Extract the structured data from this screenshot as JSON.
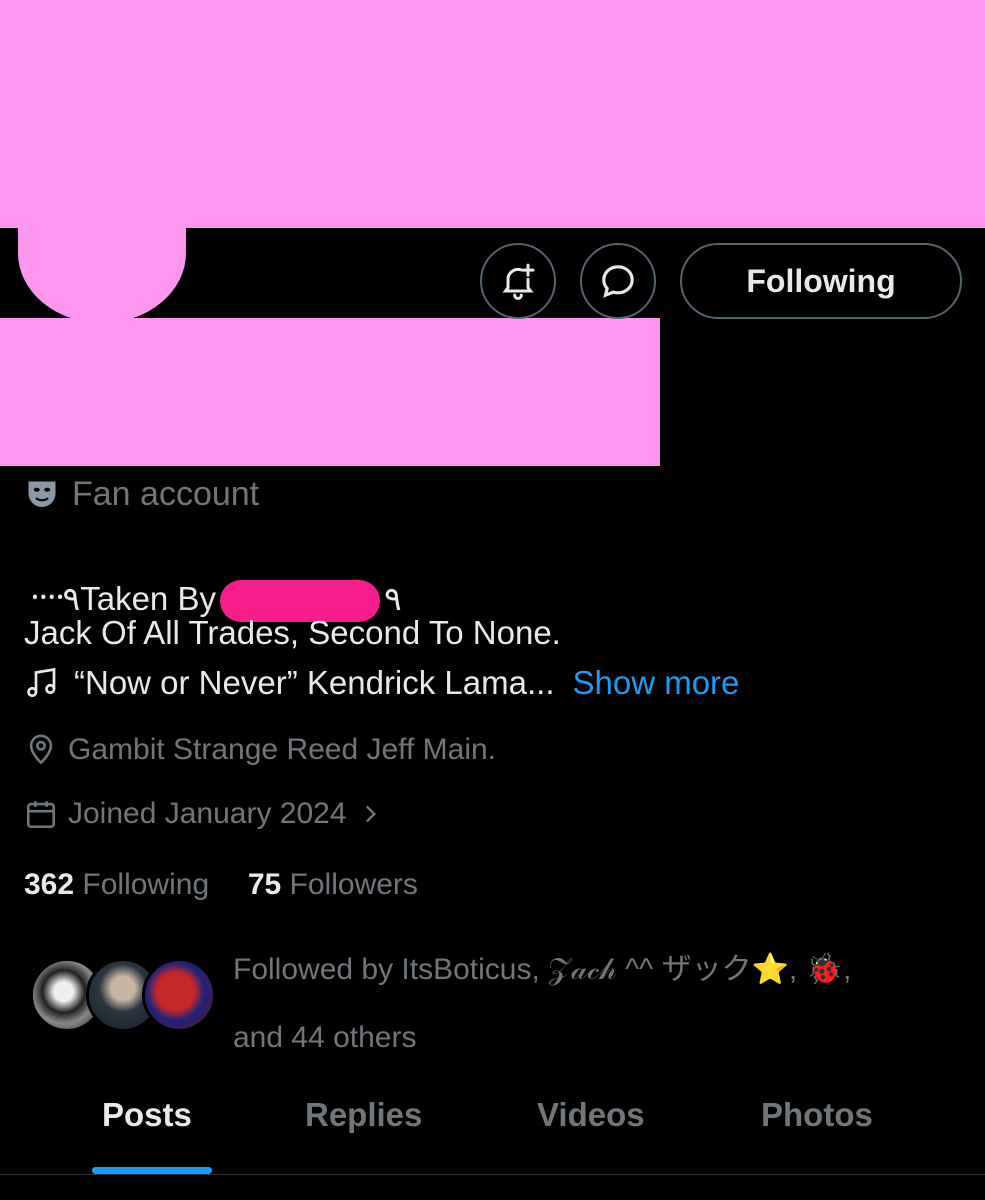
{
  "header": {
    "follow_button_label": "Following"
  },
  "profile": {
    "category_label": "Fan account",
    "bio_line1_prefix": "᠁٩Taken By",
    "bio_line1_suffix": "٩",
    "bio_line2": "Jack Of All Trades, Second To None.",
    "bio_line3": "“Now or Never” Kendrick Lama...",
    "show_more_label": "Show more",
    "location": "Gambit Strange Reed Jeff Main.",
    "joined": "Joined January 2024",
    "following_count": "362",
    "following_label": "Following",
    "followers_count": "75",
    "followers_label": "Followers",
    "followed_by_text": "Followed by ItsBoticus, 𝒵𝒶𝒸𝒽 ^^ ザック⭐, 🐞,",
    "followed_by_more": "and 44 others"
  },
  "tabs": [
    {
      "label": "Posts"
    },
    {
      "label": "Replies"
    },
    {
      "label": "Videos"
    },
    {
      "label": "Photos"
    }
  ],
  "colors": {
    "accent": "#1d9bf0",
    "redaction_pink": "#fc96ee",
    "redaction_hot_pink": "#f71d8c",
    "background": "#000000"
  },
  "icons": [
    "bell-plus-icon",
    "message-bubble-icon",
    "theater-mask-icon",
    "music-note-icon",
    "location-pin-icon",
    "calendar-icon",
    "chevron-right-icon"
  ]
}
